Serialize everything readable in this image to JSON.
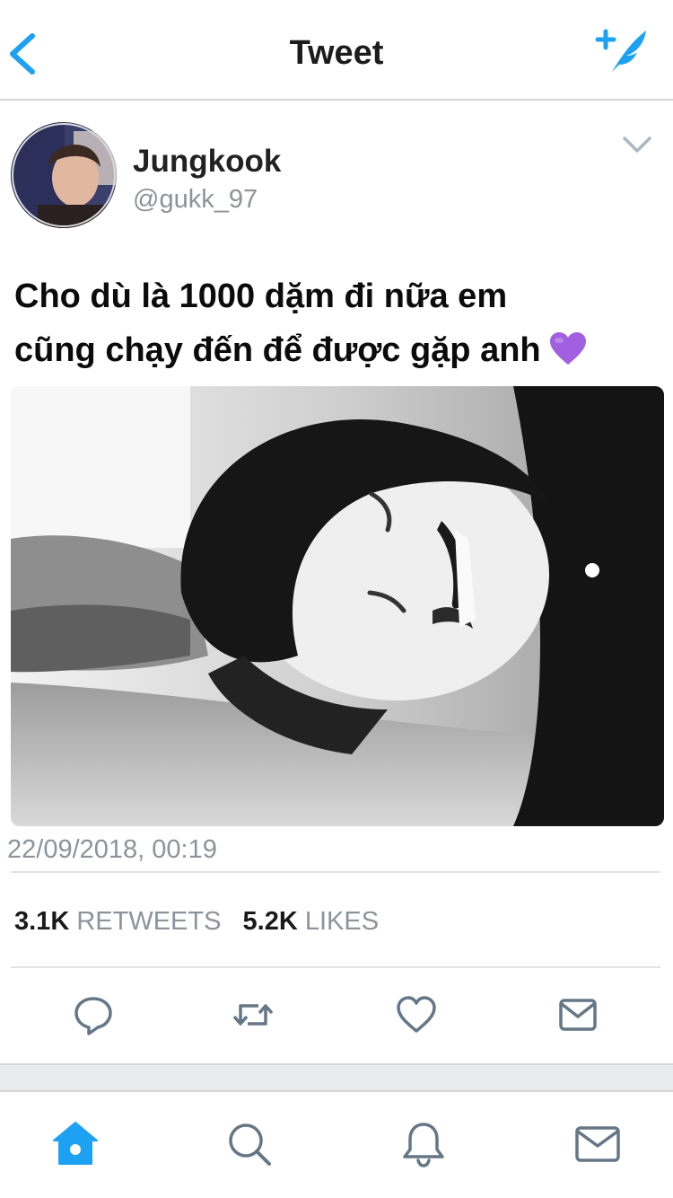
{
  "header": {
    "title": "Tweet",
    "back_icon": "chevron-left-icon",
    "compose_icon": "compose-tweet-icon",
    "accent_color": "#1da1f2"
  },
  "author": {
    "display_name": "Jungkook",
    "handle": "@gukk_97"
  },
  "tweet": {
    "text_line1": "Cho dù là 1000 dặm đi nữa em",
    "text_line2": "cũng chạy đến để được gặp anh",
    "emoji": "purple-heart",
    "timestamp": "22/09/2018, 00:19"
  },
  "stats": {
    "retweets_count": "3.1K",
    "retweets_label": "RETWEETS",
    "likes_count": "5.2K",
    "likes_label": "LIKES"
  },
  "actions": [
    "reply-icon",
    "retweet-icon",
    "like-icon",
    "direct-message-icon"
  ],
  "tabbar": {
    "items": [
      "home-icon",
      "search-icon",
      "notifications-icon",
      "messages-icon"
    ],
    "active": "home-icon"
  }
}
